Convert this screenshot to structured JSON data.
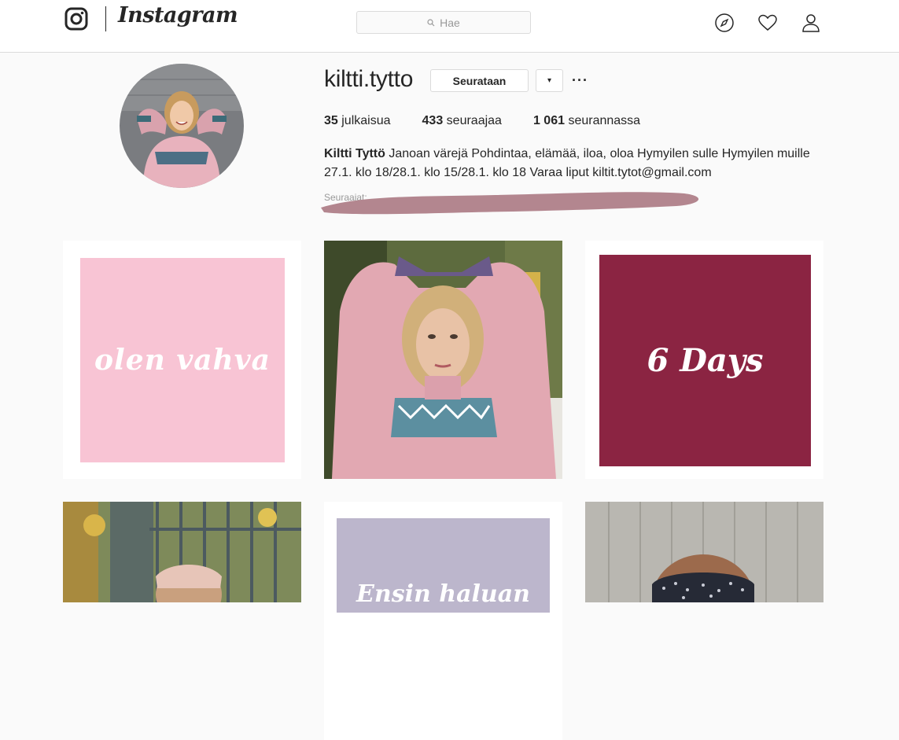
{
  "header": {
    "logo_text": "Instagram",
    "search_placeholder": "Hae",
    "icons": [
      "instagram-camera-icon",
      "search-icon",
      "explore-compass-icon",
      "heart-icon",
      "profile-icon"
    ]
  },
  "profile": {
    "username": "kiltti.tytto",
    "follow_label": "Seurataan",
    "dropdown_label": "▾",
    "more_label": "···",
    "stats": [
      {
        "count": "35",
        "label": "julkaisua"
      },
      {
        "count": "433",
        "label": "seuraajaa"
      },
      {
        "count": "1 061",
        "label": "seurannassa"
      }
    ],
    "full_name": "Kiltti Tyttö",
    "bio": "Janoan värejä Pohdintaa, elämää, iloa, oloa Hymyilen sulle Hymyilen muille 27.1. klo 18/28.1. klo 15/28.1. klo 18 Varaa liput kiltit.tytot@gmail.com",
    "followed_by_prefix": "Seuraajat:",
    "redaction_color": "#b3868f"
  },
  "posts": [
    {
      "text": "olen vahva",
      "bg": "#f8c4d4"
    },
    {
      "text": "",
      "kind": "photo"
    },
    {
      "text": "6 Days",
      "bg": "#8b2442"
    },
    {
      "text": "",
      "kind": "photo"
    },
    {
      "text": "Ensin haluan",
      "bg": "#bcb6cc"
    },
    {
      "text": "",
      "kind": "photo"
    }
  ]
}
